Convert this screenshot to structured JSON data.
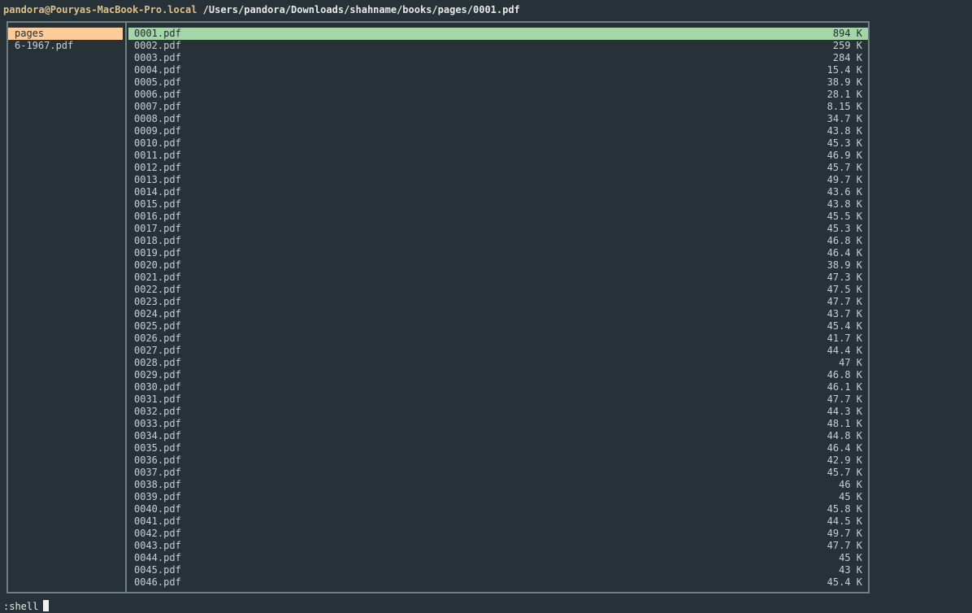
{
  "titlebar": {
    "user_host": "pandora@Pouryas-MacBook-Pro.local",
    "path": "/Users/pandora/Downloads/shahname/books/pages/0001.pdf"
  },
  "left_pane": {
    "items": [
      {
        "name": "pages",
        "selected": true
      },
      {
        "name": "6-1967.pdf",
        "selected": false
      }
    ]
  },
  "right_pane": {
    "files": [
      {
        "name": "0001.pdf",
        "size": "894 K",
        "selected": true
      },
      {
        "name": "0002.pdf",
        "size": "259 K"
      },
      {
        "name": "0003.pdf",
        "size": "284 K"
      },
      {
        "name": "0004.pdf",
        "size": "15.4 K"
      },
      {
        "name": "0005.pdf",
        "size": "38.9 K"
      },
      {
        "name": "0006.pdf",
        "size": "28.1 K"
      },
      {
        "name": "0007.pdf",
        "size": "8.15 K"
      },
      {
        "name": "0008.pdf",
        "size": "34.7 K"
      },
      {
        "name": "0009.pdf",
        "size": "43.8 K"
      },
      {
        "name": "0010.pdf",
        "size": "45.3 K"
      },
      {
        "name": "0011.pdf",
        "size": "46.9 K"
      },
      {
        "name": "0012.pdf",
        "size": "45.7 K"
      },
      {
        "name": "0013.pdf",
        "size": "49.7 K"
      },
      {
        "name": "0014.pdf",
        "size": "43.6 K"
      },
      {
        "name": "0015.pdf",
        "size": "43.8 K"
      },
      {
        "name": "0016.pdf",
        "size": "45.5 K"
      },
      {
        "name": "0017.pdf",
        "size": "45.3 K"
      },
      {
        "name": "0018.pdf",
        "size": "46.8 K"
      },
      {
        "name": "0019.pdf",
        "size": "46.4 K"
      },
      {
        "name": "0020.pdf",
        "size": "38.9 K"
      },
      {
        "name": "0021.pdf",
        "size": "47.3 K"
      },
      {
        "name": "0022.pdf",
        "size": "47.5 K"
      },
      {
        "name": "0023.pdf",
        "size": "47.7 K"
      },
      {
        "name": "0024.pdf",
        "size": "43.7 K"
      },
      {
        "name": "0025.pdf",
        "size": "45.4 K"
      },
      {
        "name": "0026.pdf",
        "size": "41.7 K"
      },
      {
        "name": "0027.pdf",
        "size": "44.4 K"
      },
      {
        "name": "0028.pdf",
        "size": "47 K"
      },
      {
        "name": "0029.pdf",
        "size": "46.8 K"
      },
      {
        "name": "0030.pdf",
        "size": "46.1 K"
      },
      {
        "name": "0031.pdf",
        "size": "47.7 K"
      },
      {
        "name": "0032.pdf",
        "size": "44.3 K"
      },
      {
        "name": "0033.pdf",
        "size": "48.1 K"
      },
      {
        "name": "0034.pdf",
        "size": "44.8 K"
      },
      {
        "name": "0035.pdf",
        "size": "46.4 K"
      },
      {
        "name": "0036.pdf",
        "size": "42.9 K"
      },
      {
        "name": "0037.pdf",
        "size": "45.7 K"
      },
      {
        "name": "0038.pdf",
        "size": "46 K"
      },
      {
        "name": "0039.pdf",
        "size": "45 K"
      },
      {
        "name": "0040.pdf",
        "size": "45.8 K"
      },
      {
        "name": "0041.pdf",
        "size": "44.5 K"
      },
      {
        "name": "0042.pdf",
        "size": "49.7 K"
      },
      {
        "name": "0043.pdf",
        "size": "47.7 K"
      },
      {
        "name": "0044.pdf",
        "size": "45 K"
      },
      {
        "name": "0045.pdf",
        "size": "43 K"
      },
      {
        "name": "0046.pdf",
        "size": "45.4 K"
      }
    ]
  },
  "command_line": {
    "text": ":shell"
  },
  "colors": {
    "background": "#263238",
    "selected_dir": "#ffcc99",
    "selected_file": "#a5d6a7",
    "border": "#6f7d84"
  }
}
